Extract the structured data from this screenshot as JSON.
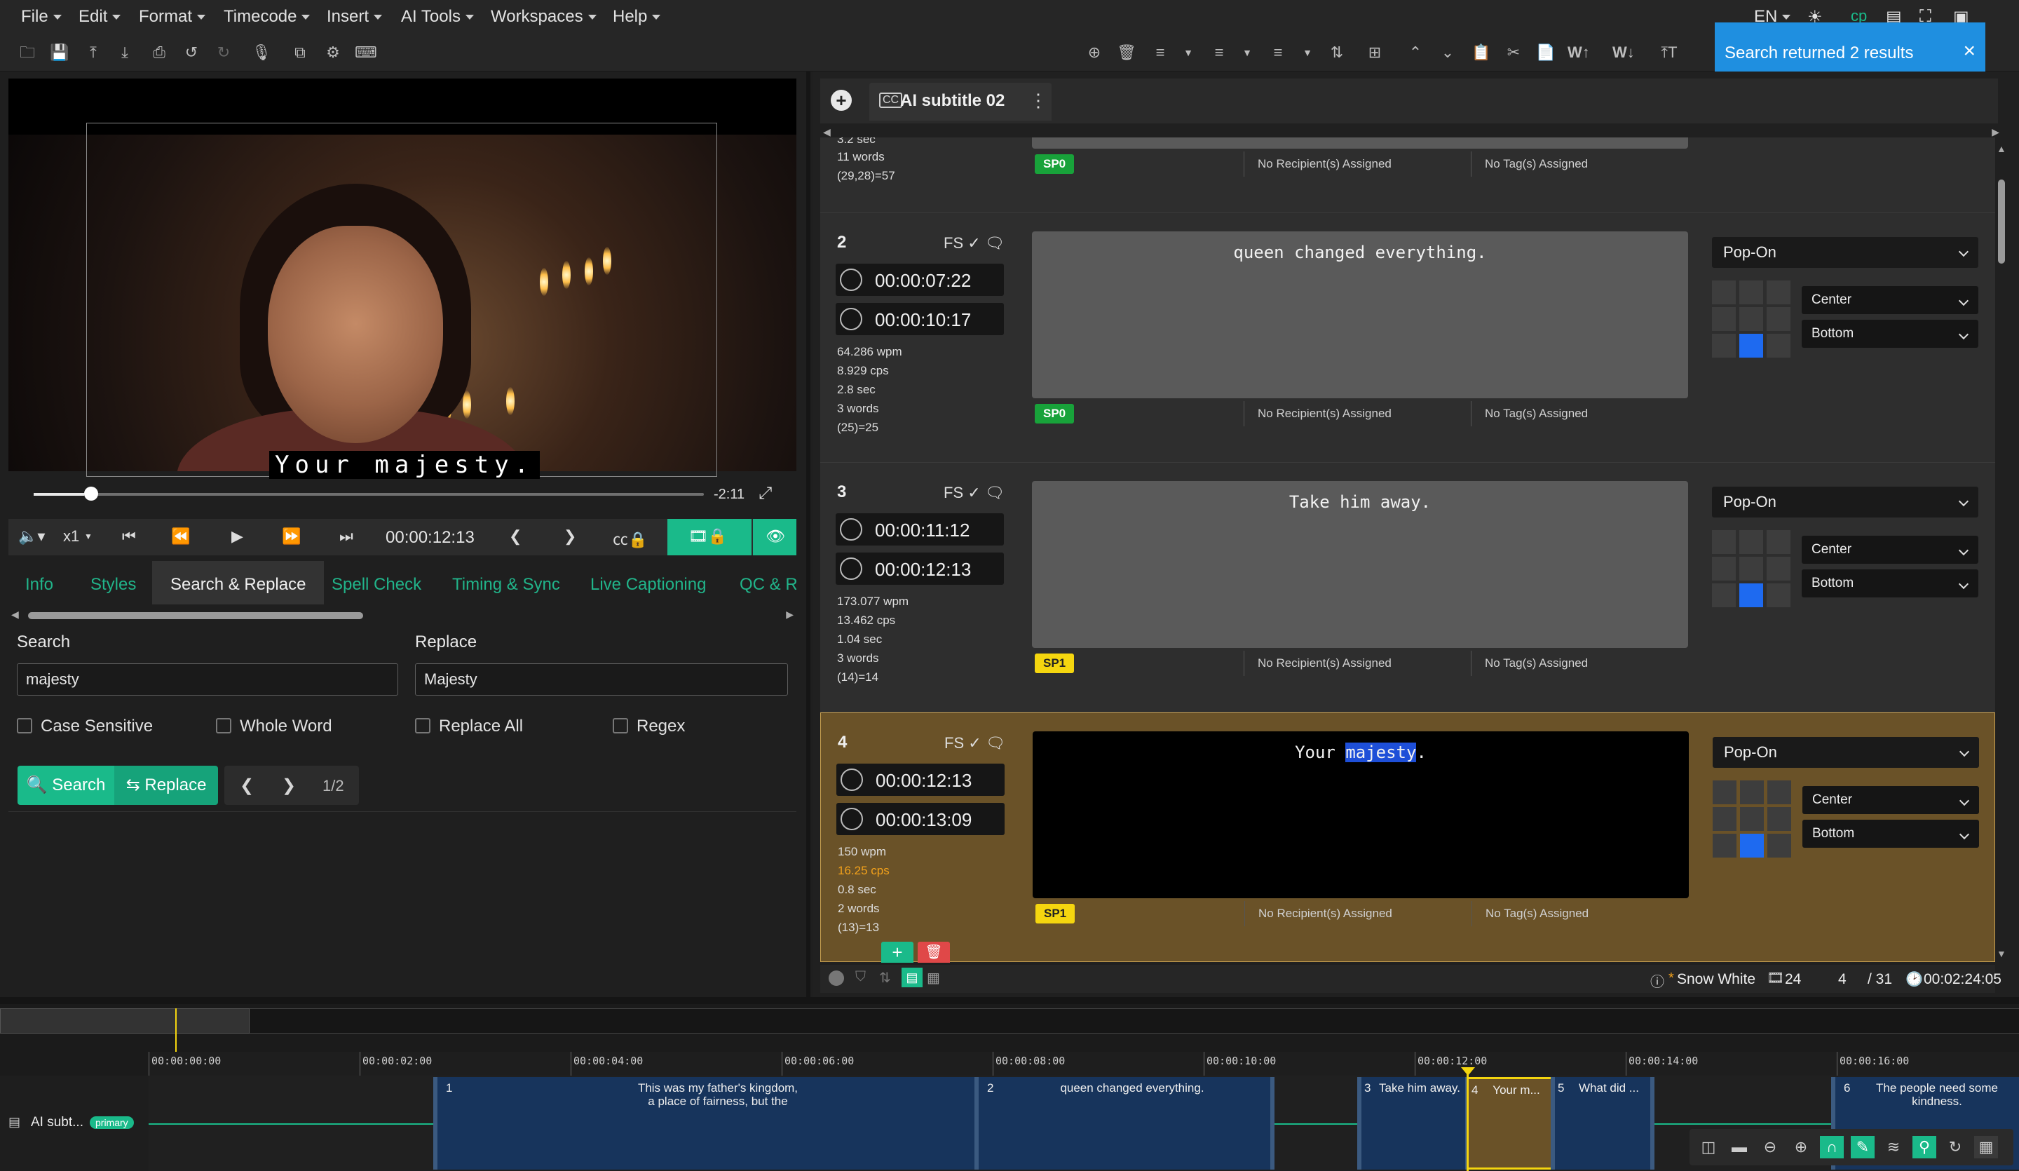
{
  "menu": [
    "File",
    "Edit",
    "Format",
    "Timecode",
    "Insert",
    "AI Tools",
    "Workspaces",
    "Help"
  ],
  "top_right": {
    "language": "EN",
    "brand": "cp"
  },
  "toast": {
    "message": "Search returned 2 results",
    "close": "×"
  },
  "video": {
    "caption": "Your majesty.",
    "time_remaining": "-2:11",
    "progress": 0.075
  },
  "transport": {
    "speed": "x1",
    "timecode": "00:00:12:13"
  },
  "tabs": [
    "Info",
    "Styles",
    "Search & Replace",
    "Spell Check",
    "Timing & Sync",
    "Live Captioning",
    "QC & Re"
  ],
  "search_panel": {
    "search_label": "Search",
    "search_value": "majesty",
    "replace_label": "Replace",
    "replace_value": "Majesty",
    "options": [
      "Case Sensitive",
      "Whole Word",
      "Replace All",
      "Regex"
    ],
    "search_button": "Search",
    "replace_button": "Replace",
    "result_index": "1/2"
  },
  "subtitle_tab": {
    "title": "AI subtitle 02",
    "cc": "CC"
  },
  "first_card_partial": {
    "stats": [
      "3.2 sec",
      "11 words",
      "(29,28)=57"
    ],
    "speaker": "SP0",
    "recipients": "No Recipient(s) Assigned",
    "tags": "No Tag(s) Assigned"
  },
  "cards": [
    {
      "num": "2",
      "flag": "FS",
      "start": "00:00:07:22",
      "end": "00:00:10:17",
      "stats": [
        "64.286 wpm",
        "8.929 cps",
        "2.8 sec",
        "3 words",
        "(25)=25"
      ],
      "text": "queen changed everything.",
      "speaker": "SP0",
      "recipients": "No Recipient(s) Assigned",
      "tags": "No Tag(s) Assigned",
      "style": "Pop-On",
      "align": "Center",
      "position": "Bottom"
    },
    {
      "num": "3",
      "flag": "FS",
      "start": "00:00:11:12",
      "end": "00:00:12:13",
      "stats": [
        "173.077 wpm",
        "13.462 cps",
        "1.04 sec",
        "3 words",
        "(14)=14"
      ],
      "text": "Take him away.",
      "speaker": "SP1",
      "recipients": "No Recipient(s) Assigned",
      "tags": "No Tag(s) Assigned",
      "style": "Pop-On",
      "align": "Center",
      "position": "Bottom"
    },
    {
      "num": "4",
      "flag": "FS",
      "start": "00:00:12:13",
      "end": "00:00:13:09",
      "stats": [
        "150 wpm",
        "16.25 cps",
        "0.8 sec",
        "2 words",
        "(13)=13"
      ],
      "text_before": "Your ",
      "text_highlight": "majesty",
      "text_after": ".",
      "speaker": "SP1",
      "recipients": "No Recipient(s) Assigned",
      "tags": "No Tag(s) Assigned",
      "style": "Pop-On",
      "align": "Center",
      "position": "Bottom"
    }
  ],
  "status": {
    "project": "Snow White",
    "fps": "24",
    "current": "4",
    "total": "/ 31",
    "duration": "00:02:24:05",
    "asterisk": "*"
  },
  "timeline": {
    "ticks": [
      "00:00:00:00",
      "00:00:02:00",
      "00:00:04:00",
      "00:00:06:00",
      "00:00:08:00",
      "00:00:10:00",
      "00:00:12:00",
      "00:00:14:00",
      "00:00:16:00"
    ],
    "track_name": "AI subt...",
    "track_badge": "primary",
    "segments": [
      {
        "n": "1",
        "text": "This was my father's kingdom,\na place of fairness, but the"
      },
      {
        "n": "2",
        "text": "queen changed everything."
      },
      {
        "n": "3",
        "text": "Take him away."
      },
      {
        "n": "4",
        "text": "Your m..."
      },
      {
        "n": "5",
        "text": "What did ..."
      },
      {
        "n": "6",
        "text": "The people need some\nkindness."
      }
    ]
  }
}
